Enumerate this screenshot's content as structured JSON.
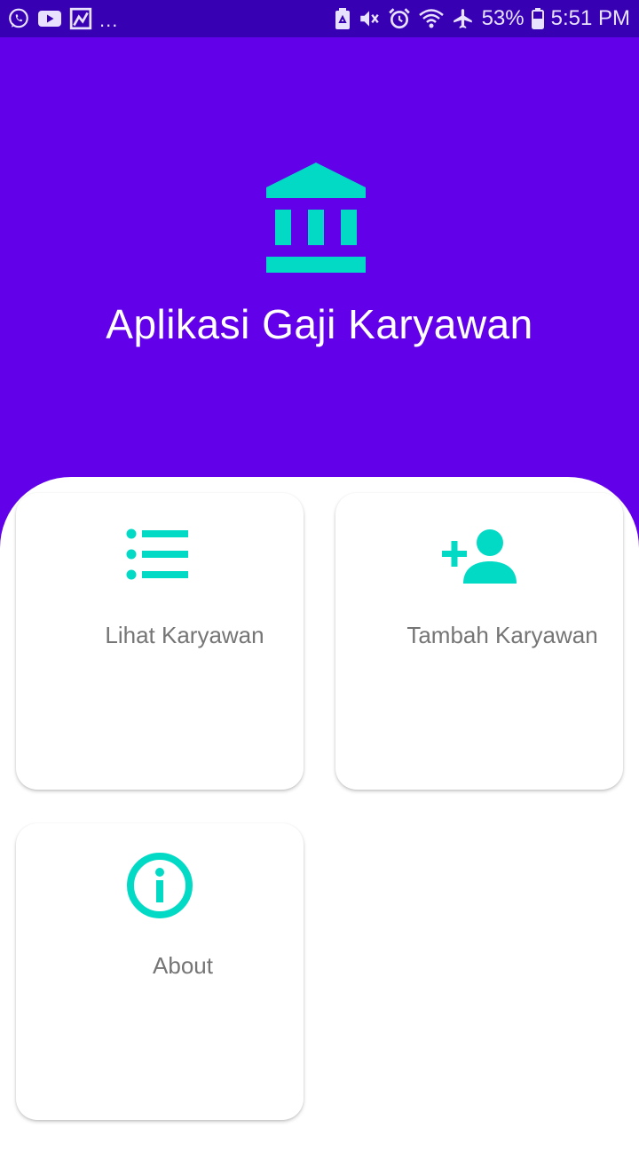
{
  "colors": {
    "status_bar": "#3700b3",
    "header": "#6200ea",
    "accent": "#03dac5",
    "card_text": "#757575",
    "title_text": "#ffffff"
  },
  "status_bar": {
    "left_icons": [
      "whatsapp-icon",
      "youtube-icon",
      "image-icon"
    ],
    "more": "...",
    "right_icons": [
      "battery-saver-icon",
      "mute-icon",
      "alarm-icon",
      "wifi-icon",
      "airplane-icon"
    ],
    "battery_percent": "53%",
    "time": "5:51 PM"
  },
  "header": {
    "logo_icon": "bank-icon",
    "title": "Aplikasi Gaji Karyawan"
  },
  "menu": {
    "lihat": {
      "label": "Lihat Karyawan",
      "icon": "list-icon"
    },
    "tambah": {
      "label": "Tambah Karyawan",
      "icon": "person-add-icon"
    },
    "about": {
      "label": "About",
      "icon": "info-icon"
    }
  }
}
